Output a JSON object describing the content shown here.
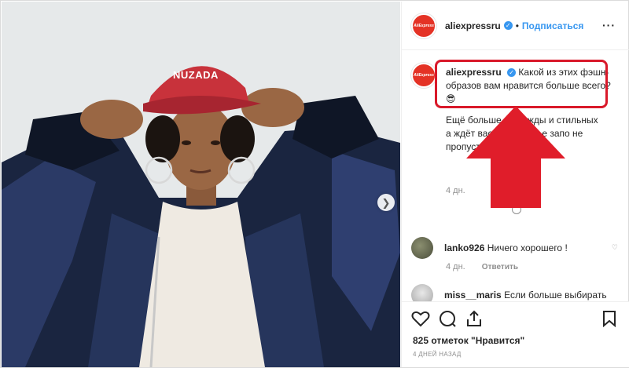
{
  "post": {
    "author": "aliexpressru",
    "avatar_text": "AliExpress",
    "follow_label": "Подписаться",
    "more_label": "···",
    "caption_line1": "Какой из этих фэшн-образов вам нравится больше всего? 😎",
    "caption_line2": "Ещё больше я одежды и стильных а ждёт вас по ссылке е запо не пропустит",
    "caption_time": "4 дн.",
    "photo_text": "NUZADA",
    "next_icon": "chevron-right"
  },
  "comments": [
    {
      "user": "lanko926",
      "text": "Ничего хорошего !",
      "time": "4 дн.",
      "reply_label": "Ответить"
    },
    {
      "user": "miss__maris",
      "text": "Если больше выбирать"
    }
  ],
  "actions": {
    "likes": "825 отметок \"Нравится\"",
    "date": "4 ДНЕЙ НАЗАД",
    "icons": [
      "heart-icon",
      "comment-icon",
      "share-icon",
      "bookmark-icon"
    ]
  },
  "colors": {
    "accent_blue": "#3897f0",
    "highlight_red": "#d9192a",
    "brand_red": "#e43225"
  }
}
